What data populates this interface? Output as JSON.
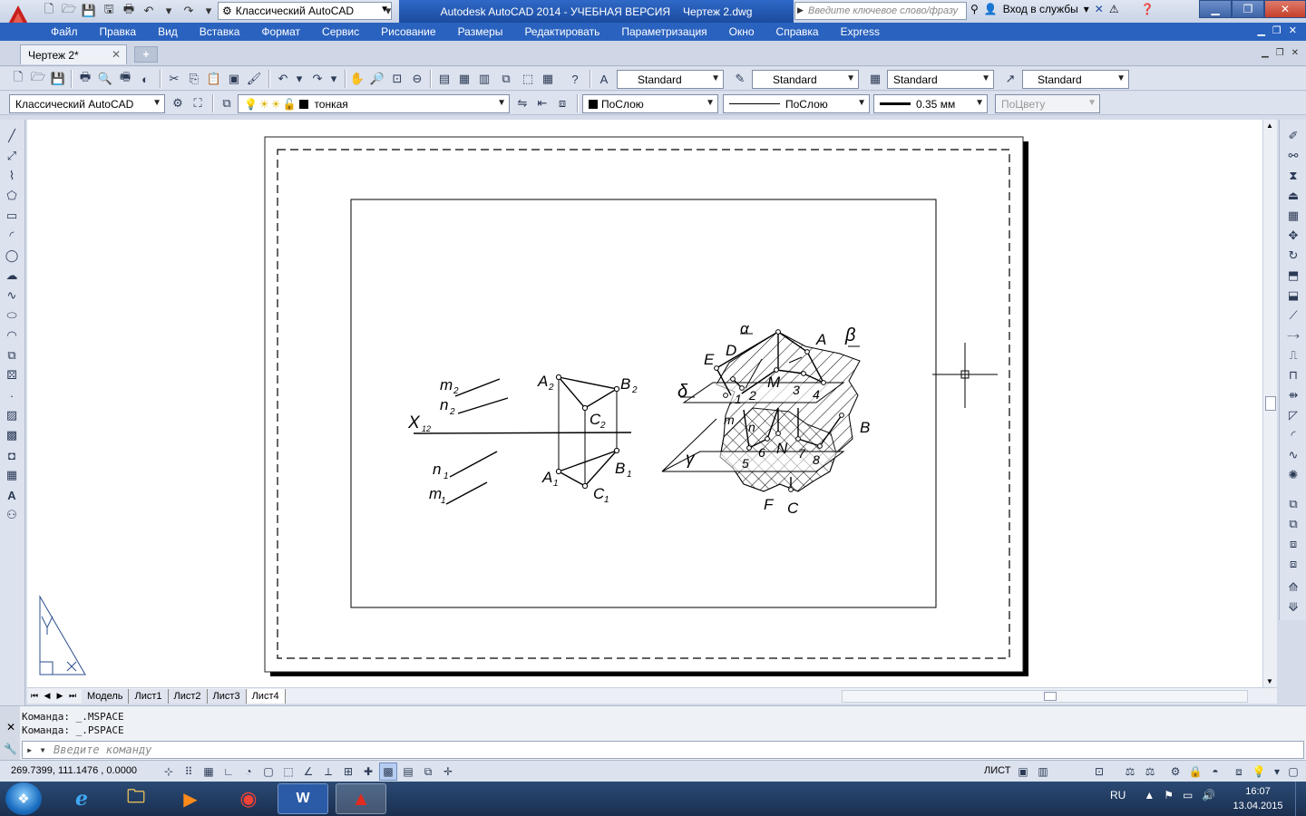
{
  "titlebar": {
    "workspace": "Классический AutoCAD",
    "app_title": "Autodesk AutoCAD 2014 - УЧЕБНАЯ ВЕРСИЯ",
    "doc_title": "Чертеж 2.dwg",
    "search_placeholder": "Введите ключевое слово/фразу",
    "signin": "Вход в службы"
  },
  "menu": [
    "Файл",
    "Правка",
    "Вид",
    "Вставка",
    "Формат",
    "Сервис",
    "Рисование",
    "Размеры",
    "Редактировать",
    "Параметризация",
    "Окно",
    "Справка",
    "Express"
  ],
  "doctab": {
    "name": "Чертеж 2*"
  },
  "toolbar1": {
    "text_style": "Standard",
    "dim_style": "Standard",
    "table_style": "Standard",
    "mleader_style": "Standard"
  },
  "toolbar2": {
    "workspace": "Классический AutoCAD",
    "layer": "тонкая",
    "color": "ПоСлою",
    "linetype": "ПоСлою",
    "lineweight": "0.35 мм",
    "plotstyle": "ПоЦвету"
  },
  "drawing": {
    "labels": {
      "m2": "m",
      "m2s": "2",
      "n2": "n",
      "n2s": "2",
      "x12": "X",
      "x12s": "12",
      "n1": "n",
      "n1s": "1",
      "m1": "m",
      "m1s": "1",
      "A2": "A",
      "A2s": "2",
      "B2": "B",
      "B2s": "2",
      "C2": "C",
      "C2s": "2",
      "A1": "A",
      "A1s": "1",
      "B1": "B",
      "B1s": "1",
      "C1": "C",
      "C1s": "1",
      "alpha": "α",
      "beta": "β",
      "delta": "δ",
      "gamma": "γ",
      "A": "A",
      "B": "B",
      "C": "C",
      "D": "D",
      "E": "E",
      "F": "F",
      "M": "M",
      "N": "N",
      "m": "m",
      "n": "n",
      "p1": "1",
      "p2": "2",
      "p3": "3",
      "p4": "4",
      "p5": "5",
      "p6": "6",
      "p7": "7",
      "p8": "8"
    }
  },
  "layout_tabs": [
    "Модель",
    "Лист1",
    "Лист2",
    "Лист3",
    "Лист4"
  ],
  "command": {
    "line1": "Команда:  _.MSPACE",
    "line2": "Команда:  _.PSPACE",
    "placeholder": "Введите команду"
  },
  "status": {
    "coords": "269.7399, 111.1476 , 0.0000",
    "space": "ЛИСТ"
  },
  "tray": {
    "lang": "RU",
    "time": "16:07",
    "date": "13.04.2015"
  },
  "colors": {
    "menubar": "#2a62bf",
    "title_active": "#1c4ba0",
    "taskbar": "#1a2f50"
  }
}
